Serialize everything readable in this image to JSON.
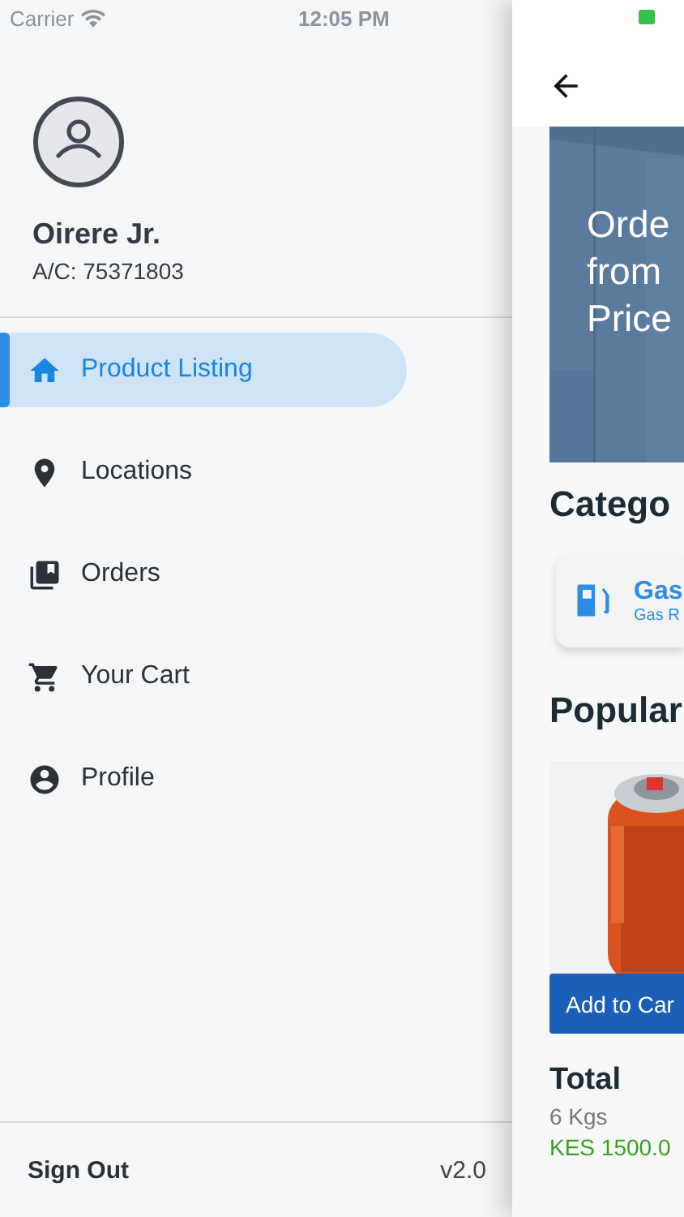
{
  "status_bar": {
    "carrier": "Carrier",
    "time": "12:05 PM"
  },
  "drawer": {
    "user": {
      "name": "Oirere Jr.",
      "account": "A/C: 75371803"
    },
    "items": [
      {
        "label": "Product Listing",
        "selected": true
      },
      {
        "label": "Locations",
        "selected": false
      },
      {
        "label": "Orders",
        "selected": false
      },
      {
        "label": "Your Cart",
        "selected": false
      },
      {
        "label": "Profile",
        "selected": false
      }
    ],
    "footer": {
      "sign_out": "Sign Out",
      "version": "v2.0"
    }
  },
  "main": {
    "banner": {
      "kind": "picture",
      "lines": [
        "Orde",
        "from",
        "Price"
      ]
    },
    "categories_title": "Catego",
    "category": {
      "title": "Gas",
      "subtitle": "Gas R"
    },
    "popular_title": "Popular",
    "product": {
      "kind": "picture",
      "button": "Add to Car",
      "title": "Total",
      "weight": "6 Kgs",
      "price": "KES 1500.0"
    }
  }
}
